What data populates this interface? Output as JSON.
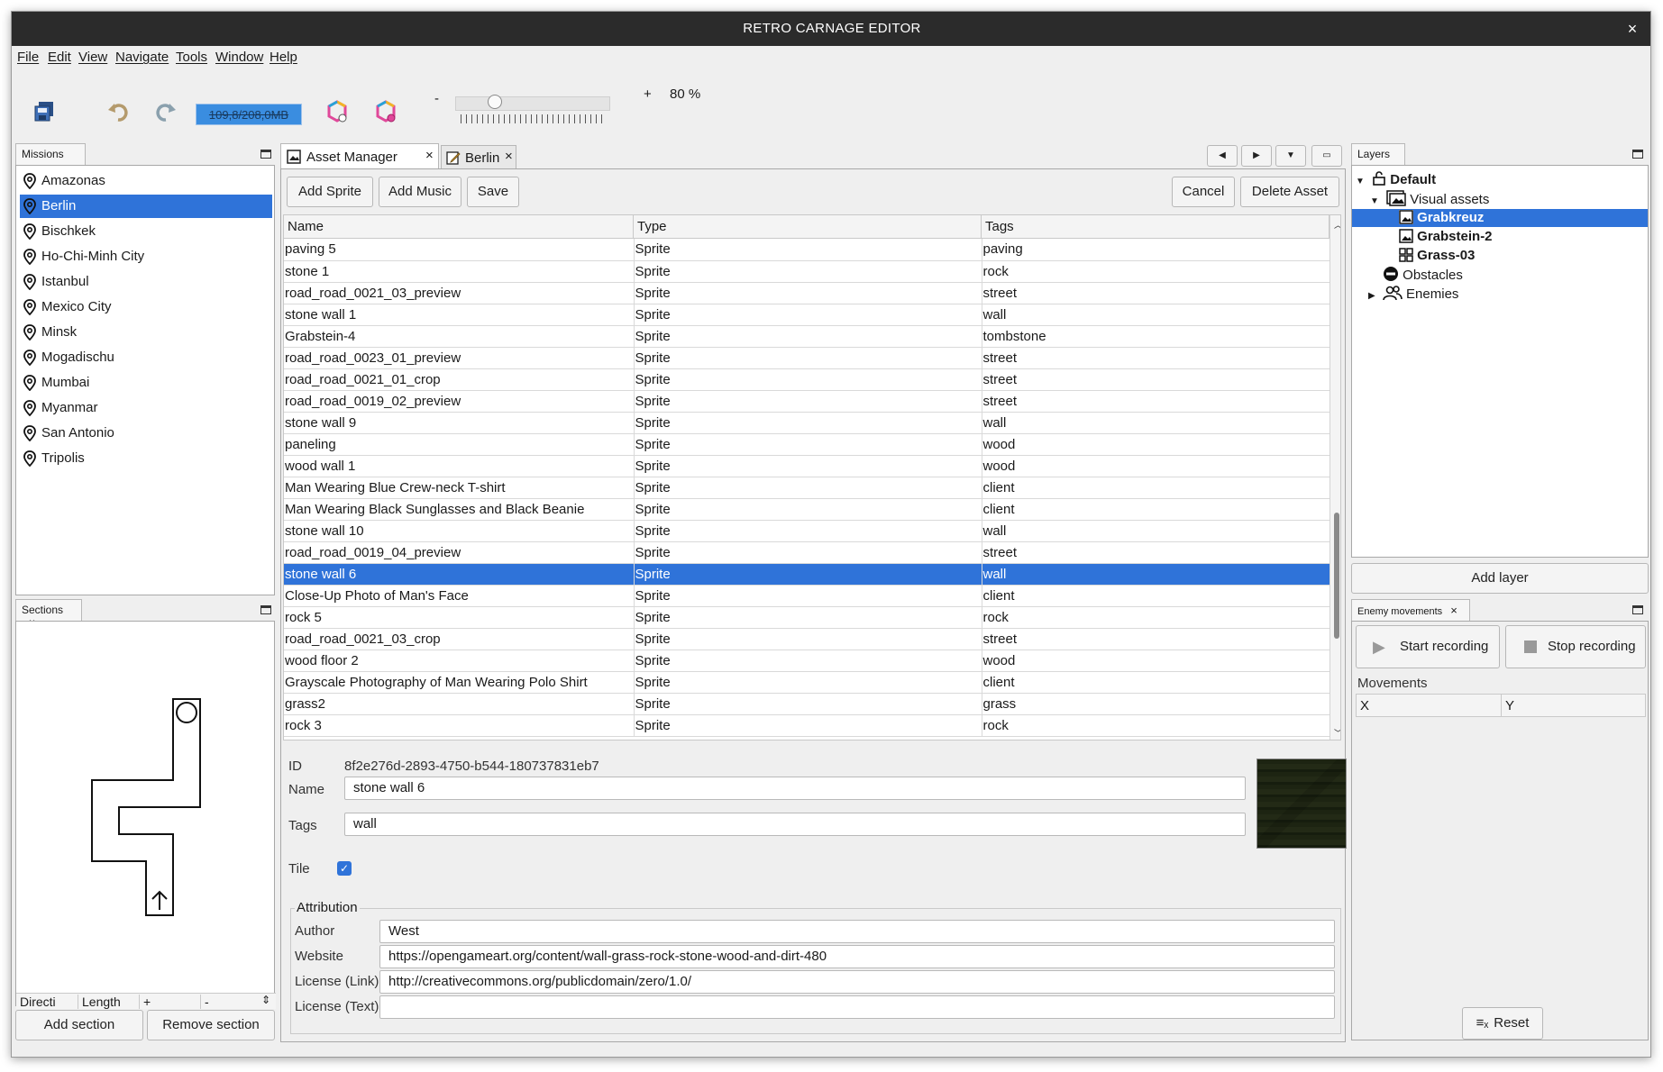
{
  "window": {
    "title": "RETRO CARNAGE EDITOR",
    "close_glyph": "×"
  },
  "menu": [
    "File",
    "Edit",
    "View",
    "Navigate",
    "Tools",
    "Window",
    "Help"
  ],
  "toolbar": {
    "memory": "109,8/208,0MB",
    "zoom_minus": "-",
    "zoom_plus": "+",
    "zoom_percent": "80 %",
    "zoom_value": 80,
    "icons": [
      "save-all-icon",
      "undo-icon",
      "redo-icon",
      "palette-icon",
      "palette-stop-icon"
    ]
  },
  "missions": {
    "title": "Missions",
    "items": [
      "Amazonas",
      "Berlin",
      "Bischkek",
      "Ho-Chi-Minh City",
      "Istanbul",
      "Mexico City",
      "Minsk",
      "Mogadischu",
      "Mumbai",
      "Myanmar",
      "San Antonio",
      "Tripolis"
    ],
    "selected_index": 1
  },
  "sections": {
    "title": "Sections",
    "close_glyph": "×",
    "columns": [
      "Directi",
      "Length",
      "+",
      "-"
    ],
    "add_label": "Add section",
    "remove_label": "Remove section"
  },
  "tabs": {
    "asset_manager": "Asset Manager",
    "berlin": "Berlin",
    "close_glyph": "×"
  },
  "asset_toolbar": {
    "add_sprite": "Add Sprite",
    "add_music": "Add Music",
    "save": "Save",
    "cancel": "Cancel",
    "delete": "Delete Asset"
  },
  "asset_table": {
    "headers": [
      "Name",
      "Type",
      "Tags"
    ],
    "rows": [
      [
        "paving 5",
        "Sprite",
        "paving"
      ],
      [
        "stone 1",
        "Sprite",
        "rock"
      ],
      [
        "road_road_0021_03_preview",
        "Sprite",
        "street"
      ],
      [
        "stone wall 1",
        "Sprite",
        "wall"
      ],
      [
        "Grabstein-4",
        "Sprite",
        "tombstone"
      ],
      [
        "road_road_0023_01_preview",
        "Sprite",
        "street"
      ],
      [
        "road_road_0021_01_crop",
        "Sprite",
        "street"
      ],
      [
        "road_road_0019_02_preview",
        "Sprite",
        "street"
      ],
      [
        "stone wall 9",
        "Sprite",
        "wall"
      ],
      [
        "paneling",
        "Sprite",
        "wood"
      ],
      [
        "wood wall 1",
        "Sprite",
        "wood"
      ],
      [
        "Man Wearing Blue Crew-neck T-shirt",
        "Sprite",
        "client"
      ],
      [
        "Man Wearing Black Sunglasses and Black Beanie",
        "Sprite",
        "client"
      ],
      [
        "stone wall 10",
        "Sprite",
        "wall"
      ],
      [
        "road_road_0019_04_preview",
        "Sprite",
        "street"
      ],
      [
        "stone wall 6",
        "Sprite",
        "wall"
      ],
      [
        "Close-Up Photo of Man's Face",
        "Sprite",
        "client"
      ],
      [
        "rock 5",
        "Sprite",
        "rock"
      ],
      [
        "road_road_0021_03_crop",
        "Sprite",
        "street"
      ],
      [
        "wood floor 2",
        "Sprite",
        "wood"
      ],
      [
        "Grayscale Photography of Man Wearing Polo Shirt",
        "Sprite",
        "client"
      ],
      [
        "grass2",
        "Sprite",
        "grass"
      ],
      [
        "rock 3",
        "Sprite",
        "rock"
      ]
    ],
    "selected_index": 15
  },
  "asset_detail": {
    "id_label": "ID",
    "id_value": "8f2e276d-2893-4750-b544-180737831eb7",
    "name_label": "Name",
    "name_value": "stone wall 6",
    "tags_label": "Tags",
    "tags_value": "wall",
    "tile_label": "Tile",
    "tile_checked": true,
    "attribution_title": "Attribution",
    "author_label": "Author",
    "author_value": "West",
    "website_label": "Website",
    "website_value": "https://opengameart.org/content/wall-grass-rock-stone-wood-and-dirt-480",
    "license_link_label": "License (Link)",
    "license_link_value": "http://creativecommons.org/publicdomain/zero/1.0/",
    "license_text_label": "License (Text)",
    "license_text_value": ""
  },
  "layers": {
    "title": "Layers",
    "tree": {
      "default": "Default",
      "visual_assets": "Visual assets",
      "grabkreuz": "Grabkreuz",
      "grabstein2": "Grabstein-2",
      "grass03": "Grass-03",
      "obstacles": "Obstacles",
      "enemies": "Enemies"
    },
    "add_layer": "Add layer"
  },
  "enemy_movements": {
    "title": "Enemy movements",
    "close_glyph": "×",
    "start_recording": "Start recording",
    "stop_recording": "Stop recording",
    "movements_label": "Movements",
    "columns": [
      "X",
      "Y"
    ],
    "reset": "Reset"
  },
  "colors": {
    "selection": "#2f73d9",
    "titlebar": "#2b2b2b",
    "memory_bar": "#3a8de0",
    "background": "#efefef"
  }
}
